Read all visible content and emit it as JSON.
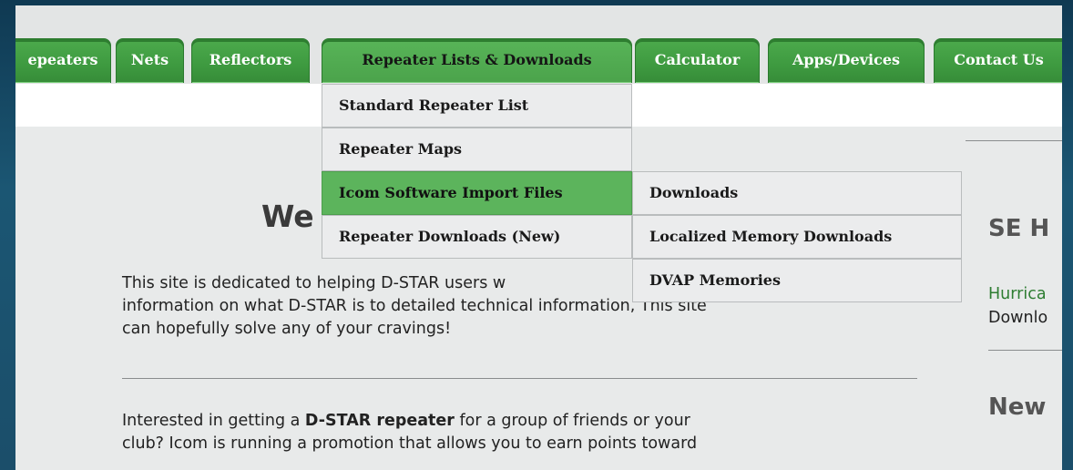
{
  "nav": {
    "tabs": [
      {
        "label": "epeaters",
        "active": false
      },
      {
        "label": "Nets",
        "active": false
      },
      {
        "label": "Reflectors",
        "active": false
      },
      {
        "label": "Repeater Lists & Downloads",
        "active": true
      },
      {
        "label": "Calculator",
        "active": false
      },
      {
        "label": "Apps/Devices",
        "active": false
      },
      {
        "label": "Contact Us",
        "active": false
      }
    ]
  },
  "dropdown": {
    "items": [
      {
        "label": "Standard Repeater List"
      },
      {
        "label": "Repeater Maps"
      },
      {
        "label": "Icom Software Import Files",
        "highlighted": true
      },
      {
        "label": "Repeater Downloads (New)"
      }
    ],
    "submenu": [
      {
        "label": "Downloads"
      },
      {
        "label": "Localized Memory Downloads"
      },
      {
        "label": "DVAP Memories"
      }
    ]
  },
  "main": {
    "welcome_heading": "We",
    "intro_line1": " This site is dedicated to helping D-STAR users w",
    "intro_line2": "information on what D-STAR is to detailed technical information, This site",
    "intro_line3": "can hopefully solve any of your cravings!",
    "promo_line1_pre": "Interested in getting a ",
    "promo_line1_bold": "D-STAR repeater",
    "promo_line1_post": " for a group of friends or your",
    "promo_line2": "club? Icom is running a promotion that allows you to earn points toward"
  },
  "sidebar": {
    "title1": "SE H",
    "link1": "Hurrica",
    "text1": "Downlo",
    "title2": "New"
  },
  "colors": {
    "tab_green": "#3e9a40",
    "highlight_green": "#5cb45c",
    "link_green": "#2e7d32",
    "outer_blue": "#1a4a66"
  }
}
